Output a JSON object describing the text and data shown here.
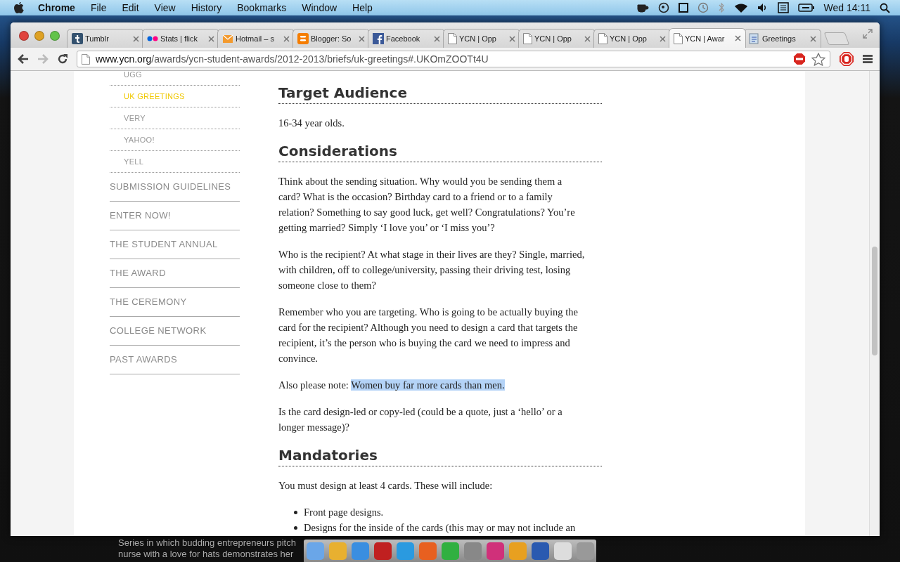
{
  "menu_bar": {
    "app": "Chrome",
    "menus": [
      "File",
      "Edit",
      "View",
      "History",
      "Bookmarks",
      "Window",
      "Help"
    ],
    "clock": "Wed 14:11"
  },
  "tabs": [
    {
      "title": "Tumblr",
      "selected": false
    },
    {
      "title": "Stats | flick",
      "selected": false
    },
    {
      "title": "Hotmail – s",
      "selected": false
    },
    {
      "title": "Blogger: So",
      "selected": false
    },
    {
      "title": "Facebook",
      "selected": false
    },
    {
      "title": "YCN | Opp",
      "selected": false
    },
    {
      "title": "YCN | Opp",
      "selected": false
    },
    {
      "title": "YCN | Opp",
      "selected": false
    },
    {
      "title": "YCN | Awar",
      "selected": true
    },
    {
      "title": "Greetings",
      "selected": false
    }
  ],
  "address_bar": {
    "domain": "www.ycn.org",
    "path": "/awards/ycn-student-awards/2012-2013/briefs/uk-greetings#.UKOmZOOTt4U"
  },
  "sidebar": {
    "sub_items": [
      {
        "label": "UGG",
        "selected": false
      },
      {
        "label": "UK GREETINGS",
        "selected": true
      },
      {
        "label": "VERY",
        "selected": false
      },
      {
        "label": "YAHOO!",
        "selected": false
      },
      {
        "label": "YELL",
        "selected": false
      }
    ],
    "items": [
      "SUBMISSION GUIDELINES",
      "ENTER NOW!",
      "THE STUDENT ANNUAL",
      "THE AWARD",
      "THE CEREMONY",
      "COLLEGE NETWORK",
      "PAST AWARDS"
    ]
  },
  "sections": [
    {
      "heading": "Target Audience",
      "blocks": [
        {
          "kind": "paragraph",
          "text": "16-34 year olds."
        }
      ]
    },
    {
      "heading": "Considerations",
      "blocks": [
        {
          "kind": "paragraph",
          "text": "Think about the sending situation. Why would you be sending them a card? What is the occasion? Birthday card to a friend or to a family relation? Something to say good luck, get well? Congratulations? You’re getting married? Simply ‘I love you’ or ‘I miss you’?"
        },
        {
          "kind": "paragraph",
          "text": "Who is the recipient? At what stage in their lives are they? Single, married, with children, off to college/university, passing their driving test, losing someone close to them?"
        },
        {
          "kind": "paragraph",
          "text": "Remember who you are targeting. Who is going to be actually buying the card for the recipient? Although you need to design a card that targets the recipient, it’s the person who is buying the card we need to impress and convince."
        },
        {
          "kind": "paragraph",
          "text": "Also please note: ",
          "highlighted": "Women buy far more cards than men."
        },
        {
          "kind": "paragraph",
          "text": "Is the card design-led or copy-led (could be a quote, just a ‘hello’ or a longer message)?"
        }
      ]
    },
    {
      "heading": "Mandatories",
      "blocks": [
        {
          "kind": "paragraph",
          "text": "You must design at least 4 cards. These will include:"
        },
        {
          "kind": "bullets",
          "items": [
            "Front page designs.",
            "Designs for the inside of the cards (this may or may not include an"
          ]
        }
      ]
    }
  ],
  "desktop_text": [
    "Series in which budding entrepreneurs pitch",
    "nurse with a love for hats demonstrates her"
  ]
}
